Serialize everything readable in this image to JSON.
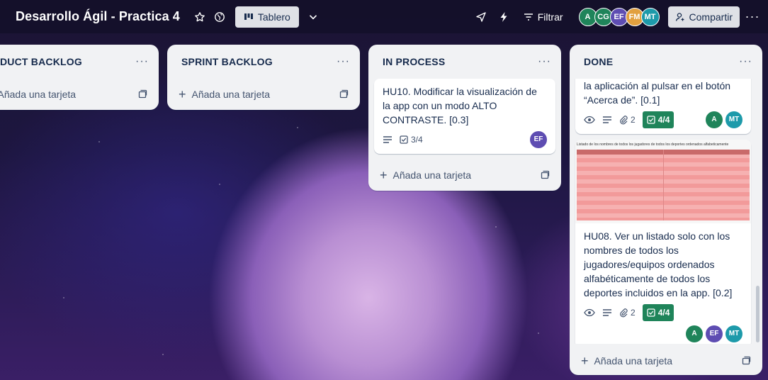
{
  "colors": {
    "avatar_a": "#1f845a",
    "avatar_cg": "#1f845a",
    "avatar_ef": "#5e4db2",
    "avatar_fm": "#e2a03f",
    "avatar_mt": "#1d9aaa",
    "done_badge": "#1f845a"
  },
  "header": {
    "board_title": "Desarrollo Ágil - Practica 4",
    "view_label": "Tablero",
    "filter_label": "Filtrar",
    "share_label": "Compartir",
    "avatars": [
      "A",
      "CG",
      "EF",
      "FM",
      "MT"
    ]
  },
  "lists": [
    {
      "title": "DUCT BACKLOG",
      "add_label": "Añada una tarjeta"
    },
    {
      "title": "SPRINT BACKLOG",
      "add_label": "Añada una tarjeta"
    },
    {
      "title": "IN PROCESS",
      "add_label": "Añada una tarjeta",
      "cards": [
        {
          "text": "HU10. Modificar la visualización de la app con un modo ALTO CONTRASTE. [0.3]",
          "checklist": "3/4",
          "members": [
            "EF"
          ]
        }
      ]
    },
    {
      "title": "DONE",
      "add_label": "Añada una tarjeta",
      "cards": [
        {
          "text": "la aplicación al pulsar en el botón “Acerca de”. [0.1]",
          "attachments": "2",
          "checklist": "4/4",
          "members": [
            "A",
            "MT"
          ]
        },
        {
          "cover_title": "Listado de los nombres de todos los jugadores de todos los deportes ordenados alfabeticamente",
          "text": "HU08. Ver un listado solo con los nombres de todos los jugadores/equipos ordenados alfabéticamente de todos los deportes incluidos en la app. [0.2]",
          "attachments": "2",
          "checklist": "4/4",
          "members": [
            "A",
            "EF",
            "MT"
          ]
        }
      ]
    }
  ]
}
